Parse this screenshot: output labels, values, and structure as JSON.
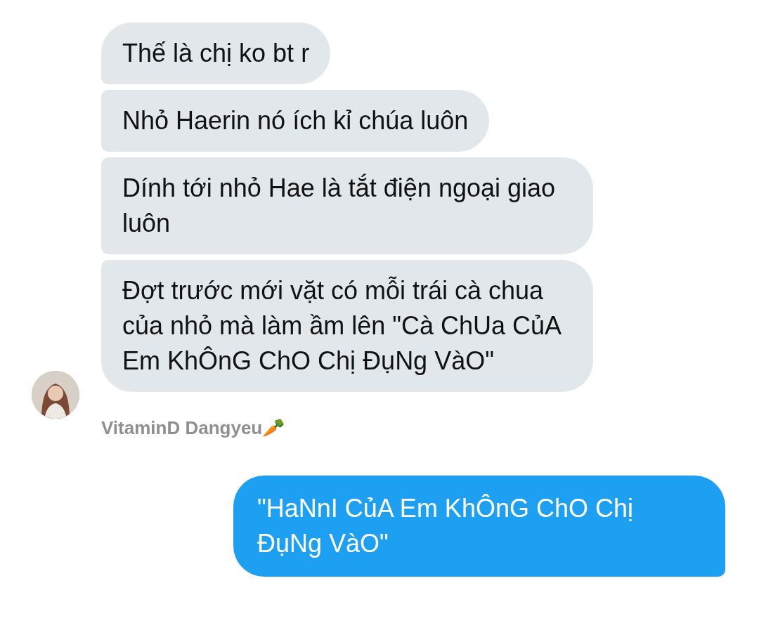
{
  "received": [
    {
      "text": "Thế là chị ko bt r"
    },
    {
      "text": "Nhỏ Haerin nó ích kỉ chúa luôn"
    },
    {
      "text": "Dính tới nhỏ Hae là tắt điện ngoại giao luôn"
    },
    {
      "text": "Đợt trước mới vặt có mỗi trái cà chua của nhỏ mà làm ầm lên \"Cà ChUa CủA Em KhÔnG ChO Chị ĐụNg VàO\""
    }
  ],
  "sender_name": "VitaminD Dangyeu🥕",
  "sent": [
    {
      "text": "\"HaNnI CủA Em KhÔnG ChO Chị ĐụNg VàO\""
    }
  ]
}
